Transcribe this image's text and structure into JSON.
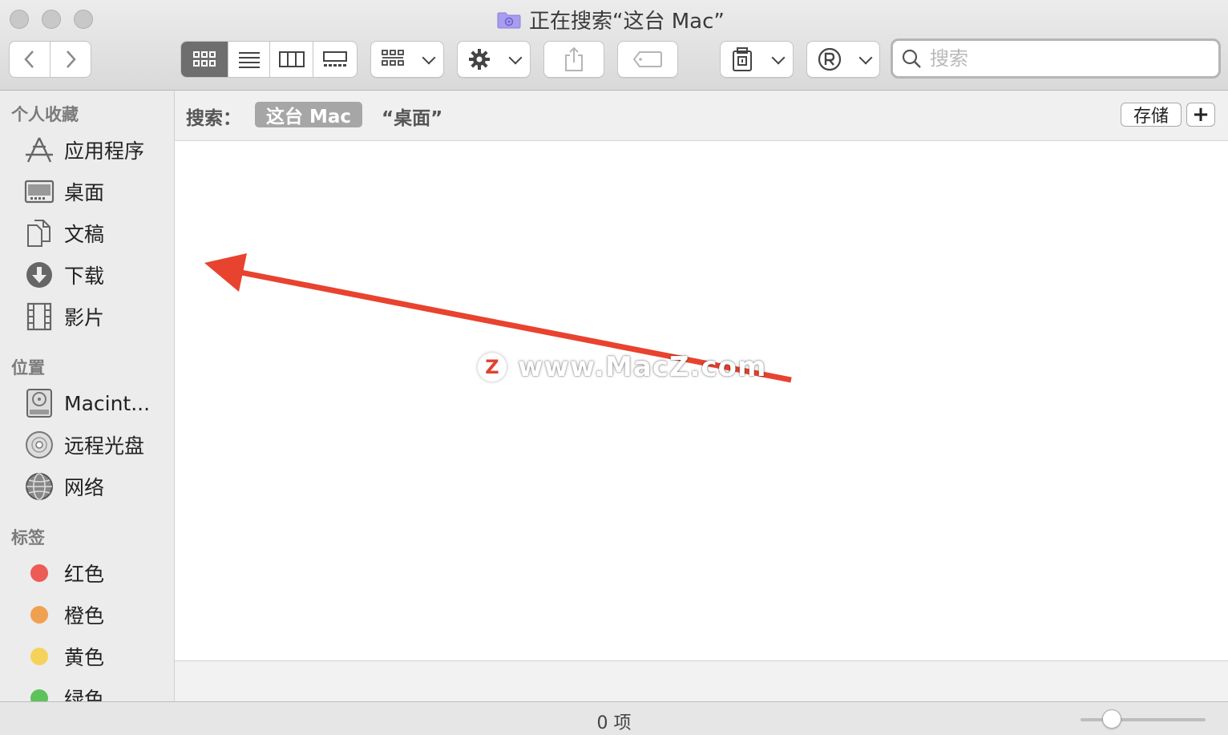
{
  "window": {
    "title": "正在搜索“这台 Mac”"
  },
  "toolbar": {
    "back_icon": "chevron-left-icon",
    "forward_icon": "chevron-right-icon",
    "view_modes": [
      "icon-view",
      "list-view",
      "column-view",
      "gallery-view"
    ],
    "active_view": "icon-view",
    "search_placeholder": "搜索"
  },
  "sidebar": {
    "favorites_title": "个人收藏",
    "favorites": [
      {
        "label": "应用程序",
        "icon": "applications-icon"
      },
      {
        "label": "桌面",
        "icon": "desktop-icon"
      },
      {
        "label": "文稿",
        "icon": "documents-icon"
      },
      {
        "label": "下载",
        "icon": "downloads-icon"
      },
      {
        "label": "影片",
        "icon": "movies-icon"
      }
    ],
    "locations_title": "位置",
    "locations": [
      {
        "label": "Macint...",
        "icon": "hard-drive-icon"
      },
      {
        "label": "远程光盘",
        "icon": "remote-disc-icon"
      },
      {
        "label": "网络",
        "icon": "network-icon"
      }
    ],
    "tags_title": "标签",
    "tags": [
      {
        "label": "红色",
        "color": "#ec5b55"
      },
      {
        "label": "橙色",
        "color": "#f0a150"
      },
      {
        "label": "黄色",
        "color": "#f5d35b"
      },
      {
        "label": "绿色",
        "color": "#5ec25a"
      }
    ]
  },
  "scope_bar": {
    "label": "搜索：",
    "active_scope": "这台 Mac",
    "other_scope": "“桌面”",
    "save_label": "存储",
    "add_label": "+"
  },
  "status": {
    "item_count": "0 项",
    "zoom_level": 0.25
  },
  "watermark": {
    "logo_letter": "Z",
    "text": "www.MacZ.com"
  },
  "colors": {
    "annotation_arrow": "#e8432f",
    "active_view_bg": "#6e6e6e",
    "scope_active_bg": "#a6a6a6"
  }
}
